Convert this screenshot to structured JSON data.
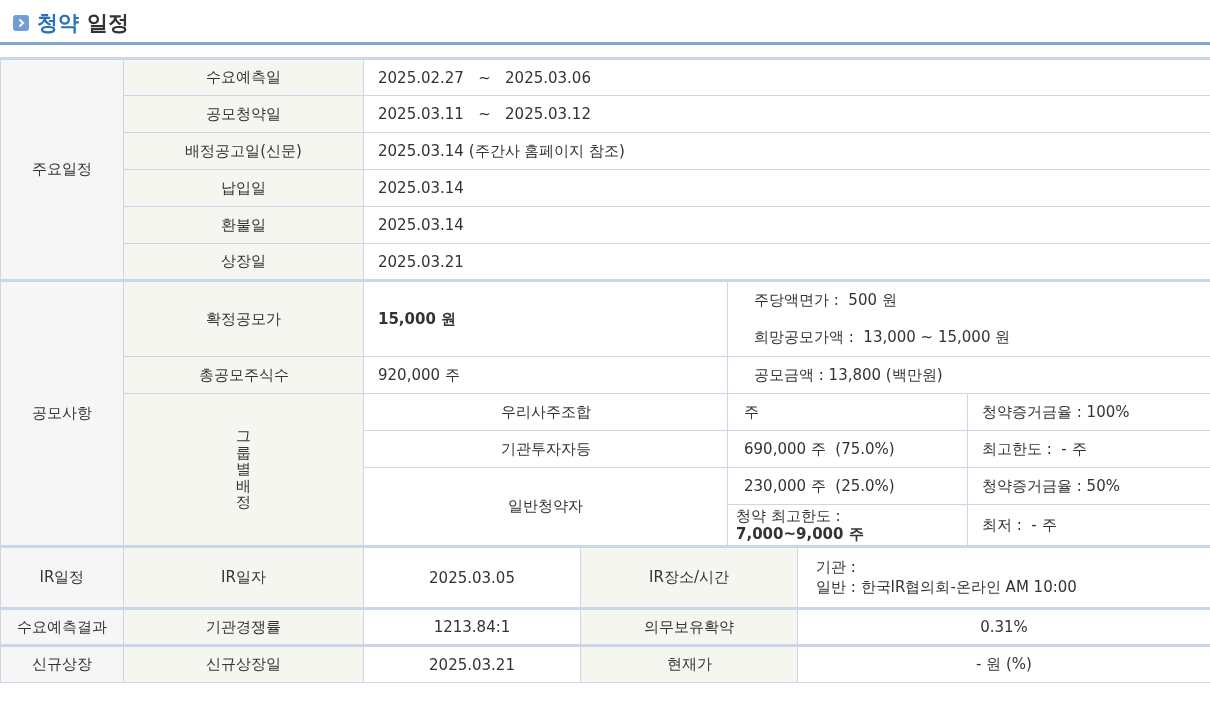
{
  "title": {
    "highlight": "청약",
    "rest": "일정"
  },
  "schedule": {
    "label": "주요일정",
    "rows": [
      {
        "label": "수요예측일",
        "value": "2025.02.27   ~   2025.03.06"
      },
      {
        "label": "공모청약일",
        "value": "2025.03.11   ~   2025.03.12"
      },
      {
        "label": "배정공고일(신문)",
        "value": "2025.03.14 (주간사 홈페이지 참조)"
      },
      {
        "label": "납입일",
        "value": "2025.03.14"
      },
      {
        "label": "환불일",
        "value": "2025.03.14"
      },
      {
        "label": "상장일",
        "value": "2025.03.21"
      }
    ]
  },
  "offering": {
    "label": "공모사항",
    "final_price": {
      "label": "확정공모가",
      "value": "15,000 원",
      "notes": [
        "주당액면가 :  500 원",
        "희망공모가액 :  13,000 ~ 15,000 원"
      ]
    },
    "total_shares": {
      "label": "총공모주식수",
      "value": "920,000 주",
      "amount": "공모금액 : 13,800 (백만원)"
    },
    "allocation": {
      "label": "그룹별배정",
      "groups": [
        {
          "name": "우리사주조합",
          "shares": "주",
          "note": "청약증거금율 : 100%"
        },
        {
          "name": "기관투자자등",
          "shares": "690,000 주  (75.0%)",
          "note": "최고한도 :  - 주"
        },
        {
          "name": "일반청약자",
          "shares": "230,000 주  (25.0%)",
          "note": "청약증거금율 : 50%",
          "limit": "청약 최고한도 : **7,000~9,000 주**",
          "minimum": "최저 :  - 주"
        }
      ]
    }
  },
  "ir": {
    "label": "IR일정",
    "date_label": "IR일자",
    "date": "2025.03.05",
    "place_label": "IR장소/시간",
    "place_lines": [
      "기관 :",
      "일반 : 한국IR협의회-온라인 AM 10:00"
    ]
  },
  "demand": {
    "label": "수요예측결과",
    "rate_label": "기관경쟁률",
    "rate": "1213.84:1",
    "lockup_label": "의무보유확약",
    "lockup": "0.31%"
  },
  "listing": {
    "label": "신규상장",
    "date_label": "신규상장일",
    "date": "2025.03.21",
    "price_label": "현재가",
    "price": "- 원 (%)"
  }
}
